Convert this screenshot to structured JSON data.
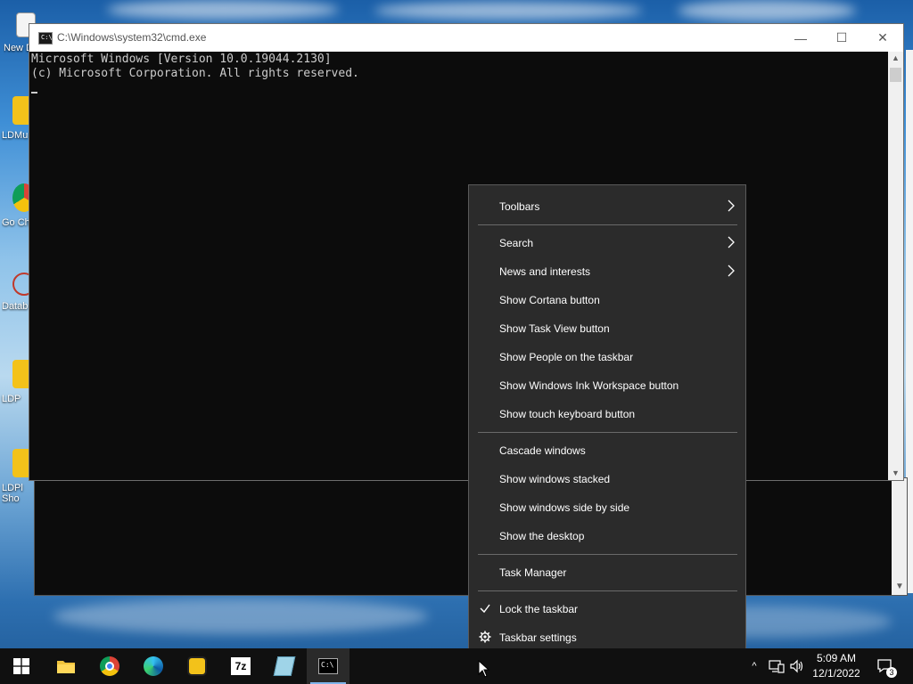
{
  "desktop": {
    "icons": [
      {
        "label": "New Docu",
        "icon": "document-icon"
      },
      {
        "label": "LDMu",
        "icon": "ldplayer-multi-icon"
      },
      {
        "label": "Go Ch",
        "icon": "chrome-icon"
      },
      {
        "label": "Datab",
        "icon": "database-icon"
      },
      {
        "label": "LDP",
        "icon": "ldplayer-icon"
      },
      {
        "label": "LDPl Sho",
        "icon": "ldplayer-store-icon"
      }
    ]
  },
  "cmd_window": {
    "title": "C:\\Windows\\system32\\cmd.exe",
    "controls": {
      "minimize": "—",
      "maximize": "☐",
      "close": "✕"
    },
    "console_lines": [
      "Microsoft Windows [Version 10.0.19044.2130]",
      "(c) Microsoft Corporation. All rights reserved."
    ]
  },
  "context_menu": {
    "items": [
      {
        "label": "Toolbars",
        "submenu": true
      },
      {
        "label": "Search",
        "submenu": true
      },
      {
        "label": "News and interests",
        "submenu": true
      },
      {
        "label": "Show Cortana button"
      },
      {
        "label": "Show Task View button"
      },
      {
        "label": "Show People on the taskbar"
      },
      {
        "label": "Show Windows Ink Workspace button"
      },
      {
        "label": "Show touch keyboard button"
      },
      {
        "label": "Cascade windows"
      },
      {
        "label": "Show windows stacked"
      },
      {
        "label": "Show windows side by side"
      },
      {
        "label": "Show the desktop"
      },
      {
        "label": "Task Manager"
      },
      {
        "label": "Lock the taskbar",
        "checked": true
      },
      {
        "label": "Taskbar settings",
        "icon": "gear-icon"
      }
    ]
  },
  "taskbar": {
    "pinned": [
      {
        "name": "start",
        "icon": "windows-logo-icon"
      },
      {
        "name": "file-explorer",
        "icon": "folder-icon"
      },
      {
        "name": "chrome",
        "icon": "chrome-icon"
      },
      {
        "name": "edge",
        "icon": "edge-icon"
      },
      {
        "name": "ldplayer",
        "icon": "ldplayer-icon"
      },
      {
        "name": "7zip",
        "icon": "seven-zip-icon",
        "text": "7z"
      },
      {
        "name": "app",
        "icon": "notepad-icon"
      },
      {
        "name": "cmd",
        "icon": "cmd-icon",
        "active": true
      }
    ],
    "tray": {
      "chevron": "^",
      "clock_time": "5:09 AM",
      "clock_date": "12/1/2022",
      "notifications_count": "3"
    }
  },
  "colors": {
    "menu_bg": "#2b2b2b",
    "taskbar_bg": "#101010",
    "console_bg": "#0c0c0c",
    "console_text": "#cccccc",
    "accent": "#7eb4ea"
  }
}
